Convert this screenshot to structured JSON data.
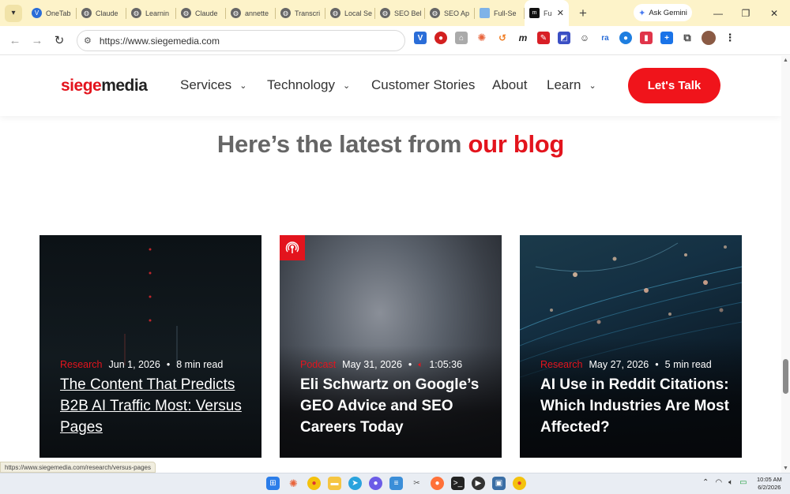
{
  "browser": {
    "tabs": [
      {
        "label": "OneTab",
        "icon": "onetab-icon",
        "color": "#2a6dd8"
      },
      {
        "label": "Claude",
        "icon": "globe-icon",
        "color": "#666666"
      },
      {
        "label": "Learnin",
        "icon": "globe-icon",
        "color": "#666666"
      },
      {
        "label": "Claude",
        "icon": "globe-icon",
        "color": "#666666"
      },
      {
        "label": "annette",
        "icon": "globe-icon",
        "color": "#666666"
      },
      {
        "label": "Transcri",
        "icon": "globe-icon",
        "color": "#666666"
      },
      {
        "label": "Local Se",
        "icon": "globe-icon",
        "color": "#666666"
      },
      {
        "label": "SEO Bel",
        "icon": "globe-icon",
        "color": "#666666"
      },
      {
        "label": "SEO Ap",
        "icon": "globe-icon",
        "color": "#666666"
      },
      {
        "label": "Full-Se",
        "icon": "doc-icon",
        "color": "#7fb3e8"
      }
    ],
    "active_tab": {
      "label": "Fu",
      "icon": "siege-icon"
    },
    "gemini_label": "Ask Gemini",
    "url": "https://www.siegemedia.com",
    "status_url": "https://www.siegemedia.com/research/versus-pages"
  },
  "site": {
    "logo_part1": "siege",
    "logo_part2": "media",
    "nav": {
      "services": "Services",
      "technology": "Technology",
      "customer_stories": "Customer Stories",
      "about": "About",
      "learn": "Learn"
    },
    "cta": "Let's Talk",
    "headline_part1": "Here’s the latest from ",
    "headline_part2": "our blog",
    "brand_red": "#e3141d"
  },
  "cards": [
    {
      "category": "Research",
      "date": "Jun 1, 2026",
      "extra": "8 min read",
      "title": "The Content That Predicts B2B AI Traffic Most: Versus Pages"
    },
    {
      "category": "Podcast",
      "date": "May 31, 2026",
      "extra": "1:05:36",
      "title": "Eli Schwartz on Google’s GEO Advice and SEO Careers Today"
    },
    {
      "category": "Research",
      "date": "May 27, 2026",
      "extra": "5 min read",
      "title": "AI Use in Reddit Citations: Which Industries Are Most Affected?"
    }
  ],
  "taskbar": {
    "time": "10:05 AM",
    "date": "6/2/2026"
  }
}
